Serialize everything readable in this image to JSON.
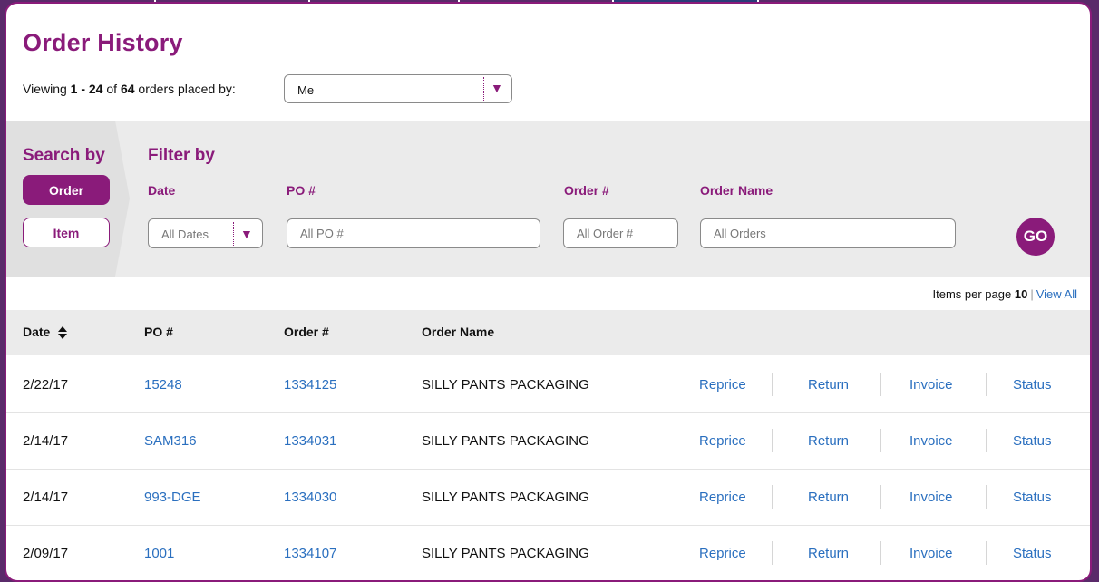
{
  "header": {
    "title": "Order History",
    "viewing_prefix": "Viewing ",
    "range": "1 - 24",
    "of_text": " of ",
    "total": "64",
    "suffix": " orders placed by:",
    "placed_by": "Me"
  },
  "search": {
    "title": "Search by",
    "order_label": "Order",
    "item_label": "Item"
  },
  "filter": {
    "title": "Filter by",
    "date_label": "Date",
    "date_value": "All Dates",
    "po_label": "PO #",
    "po_placeholder": "All PO #",
    "order_label": "Order #",
    "order_placeholder": "All Order #",
    "name_label": "Order Name",
    "name_placeholder": "All Orders",
    "go_label": "GO"
  },
  "pagination": {
    "items_per_page_label": "Items per page ",
    "items_per_page": "10",
    "separator": "|",
    "view_all": "View All"
  },
  "table": {
    "columns": [
      "Date",
      "PO #",
      "Order #",
      "Order Name"
    ],
    "actions": [
      "Reprice",
      "Return",
      "Invoice",
      "Status"
    ],
    "rows": [
      {
        "date": "2/22/17",
        "po": "15248",
        "order": "1334125",
        "name": "SILLY PANTS PACKAGING"
      },
      {
        "date": "2/14/17",
        "po": "SAM316",
        "order": "1334031",
        "name": "SILLY PANTS PACKAGING"
      },
      {
        "date": "2/14/17",
        "po": "993-DGE",
        "order": "1334030",
        "name": "SILLY PANTS PACKAGING"
      },
      {
        "date": "2/09/17",
        "po": "1001",
        "order": "1334107",
        "name": "SILLY PANTS PACKAGING"
      }
    ]
  },
  "colors": {
    "brand": "#8a1b7a",
    "link": "#2a6fbf",
    "band": "#ebebeb"
  }
}
